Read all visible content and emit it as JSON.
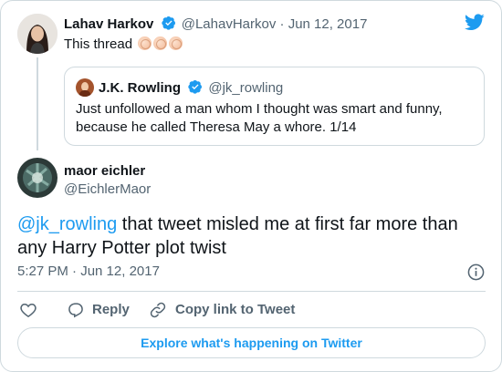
{
  "colors": {
    "accent": "#1d9bf0",
    "muted": "#536471",
    "border": "#cfd9de",
    "text": "#0f1419"
  },
  "parent_tweet": {
    "display_name": "Lahav Harkov",
    "handle": "@LahavHarkov",
    "separator": "·",
    "date": "Jun 12, 2017",
    "text": "This thread",
    "emojis": [
      "clap-emoji",
      "clap-emoji",
      "clap-emoji"
    ],
    "verified": true
  },
  "quoted_tweet": {
    "display_name": "J.K. Rowling",
    "handle": "@jk_rowling",
    "text": "Just unfollowed a man whom I thought was smart and funny, because he called Theresa May a whore.  1/14",
    "verified": true
  },
  "main_tweet": {
    "display_name": "maor eichler",
    "handle": "@EichlerMaor",
    "mention": "@jk_rowling",
    "text": " that tweet misled me at first far more than any Harry Potter plot twist",
    "time": "5:27 PM · Jun 12, 2017"
  },
  "actions": {
    "reply_label": "Reply",
    "copy_link_label": "Copy link to Tweet"
  },
  "footer": {
    "explore_label": "Explore what's happening on Twitter"
  },
  "icons": [
    "twitter-bird-icon",
    "verified-badge-icon",
    "info-icon",
    "heart-icon",
    "reply-icon",
    "link-icon"
  ]
}
